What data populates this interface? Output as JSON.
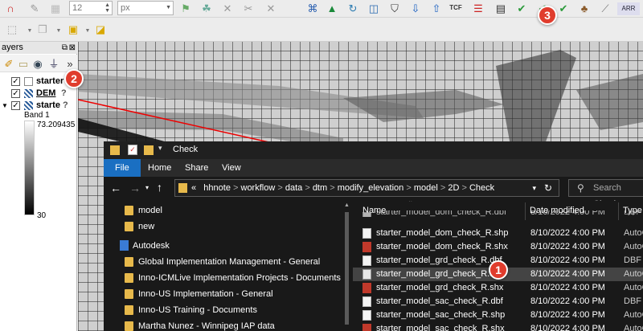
{
  "toolbar": {
    "size_value": "12",
    "unit_value": "px"
  },
  "layers_panel": {
    "title": "ayers",
    "layers": [
      {
        "name": "starter",
        "checked": true
      },
      {
        "name": "DEM",
        "checked": true
      },
      {
        "name": "starte",
        "checked": true
      }
    ],
    "band_label": "Band 1",
    "max_value": "73.209435",
    "min_value": "30"
  },
  "explorer": {
    "title": "Check",
    "ribbon_tabs": [
      "File",
      "Home",
      "Share",
      "View"
    ],
    "breadcrumb": [
      "hhnote",
      "workflow",
      "data",
      "dtm",
      "modify_elevation",
      "model",
      "2D",
      "Check"
    ],
    "breadcrumb_prefix": "«",
    "search_placeholder": "Search Check",
    "nav_items": [
      {
        "label": "model",
        "type": "folder"
      },
      {
        "label": "new",
        "type": "folder"
      },
      {
        "label": "Autodesk",
        "type": "org"
      },
      {
        "label": "Global Implementation Management - General",
        "type": "folder"
      },
      {
        "label": "Inno-ICMLive Implementation Projects - Documents",
        "type": "folder"
      },
      {
        "label": "Inno-US Implementation - General",
        "type": "folder"
      },
      {
        "label": "Inno-US Training - Documents",
        "type": "folder"
      },
      {
        "label": "Martha Nunez - Winnipeg IAP data",
        "type": "folder"
      }
    ],
    "columns": [
      "Name",
      "Date modified",
      "Type"
    ],
    "files": [
      {
        "name": "starter_model_dom_check_R.dbf",
        "date": "8/10/2022 4:00 PM",
        "type": "DBF Fi",
        "icon": "doc",
        "partial": true
      },
      {
        "name": "starter_model_dom_check_R.shp",
        "date": "8/10/2022 4:00 PM",
        "type": "AutoC",
        "icon": "doc"
      },
      {
        "name": "starter_model_dom_check_R.shx",
        "date": "8/10/2022 4:00 PM",
        "type": "AutoC",
        "icon": "shx"
      },
      {
        "name": "starter_model_grd_check_R.dbf",
        "date": "8/10/2022 4:00 PM",
        "type": "DBF Fi",
        "icon": "doc"
      },
      {
        "name": "starter_model_grd_check_R.shp",
        "date": "8/10/2022 4:00 PM",
        "type": "AutoC",
        "icon": "shp",
        "selected": true
      },
      {
        "name": "starter_model_grd_check_R.shx",
        "date": "8/10/2022 4:00 PM",
        "type": "AutoC",
        "icon": "shx"
      },
      {
        "name": "starter_model_sac_check_R.dbf",
        "date": "8/10/2022 4:00 PM",
        "type": "DBF Fi",
        "icon": "doc"
      },
      {
        "name": "starter_model_sac_check_R.shp",
        "date": "8/10/2022 4:00 PM",
        "type": "AutoC",
        "icon": "doc"
      },
      {
        "name": "starter_model_sac_check_R.shx",
        "date": "8/10/2022 4:00 PM",
        "type": "AutoC",
        "icon": "shx"
      }
    ]
  },
  "callouts": [
    "1",
    "2",
    "3"
  ],
  "colors": {
    "callout": "#e03c2d",
    "explorer_bg": "#191919",
    "file_tab": "#1a6fc2",
    "folder": "#e7b94b",
    "selection": "#444444"
  }
}
